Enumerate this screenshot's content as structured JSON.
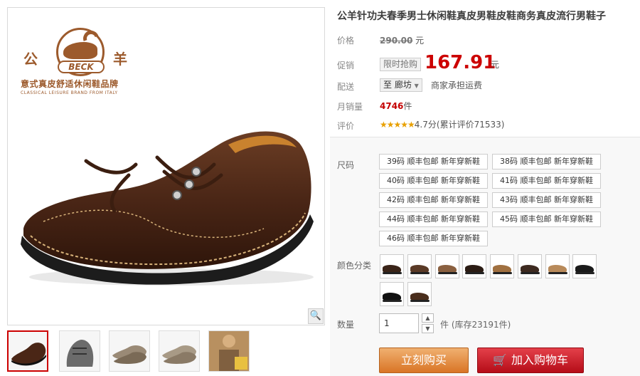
{
  "product": {
    "title": "公羊针功夫春季男士休闲鞋真皮男鞋皮鞋商务真皮流行男鞋子",
    "brand_left": "公",
    "brand_right": "羊",
    "brand_name": "BECK",
    "brand_slogan": "意式真皮舒适休闲鞋品牌",
    "brand_en": "CLASSICAL LEISURE BRAND FROM ITALY"
  },
  "price": {
    "label": "价格",
    "original": "290.00",
    "unit": "元"
  },
  "promo": {
    "label": "促销",
    "tag": "限时抢购",
    "price": "167.91",
    "unit": "元"
  },
  "shipping": {
    "label": "配送",
    "destination": "至 廊坊",
    "note": "商家承担运费"
  },
  "sales": {
    "label": "月销量",
    "count": "4746",
    "unit": "件"
  },
  "rating": {
    "label": "评价",
    "stars": "★★★★★",
    "score": "4.7分(累计评价71533)"
  },
  "sizes": {
    "label": "尺码",
    "options": [
      "39码 顺丰包邮 新年穿新鞋",
      "38码 顺丰包邮 新年穿新鞋",
      "40码 顺丰包邮 新年穿新鞋",
      "41码 顺丰包邮 新年穿新鞋",
      "42码 顺丰包邮 新年穿新鞋",
      "43码 顺丰包邮 新年穿新鞋",
      "44码 顺丰包邮 新年穿新鞋",
      "45码 顺丰包邮 新年穿新鞋",
      "46码 顺丰包邮 新年穿新鞋"
    ]
  },
  "colors": {
    "label": "颜色分类",
    "swatches": [
      "#3a2418",
      "#5a3a26",
      "#8a6040",
      "#2b1c14",
      "#a07040",
      "#3d2a20",
      "#b88a5a",
      "#1a1a1a",
      "#111111",
      "#4a2e1c"
    ]
  },
  "quantity": {
    "label": "数量",
    "value": "1",
    "up": "▲",
    "down": "▼",
    "stock": "件 (库存23191件)"
  },
  "actions": {
    "buy": "立刻购买",
    "cart": "加入购物车",
    "cart_icon": "🛒"
  },
  "zoom_icon": "🔍"
}
